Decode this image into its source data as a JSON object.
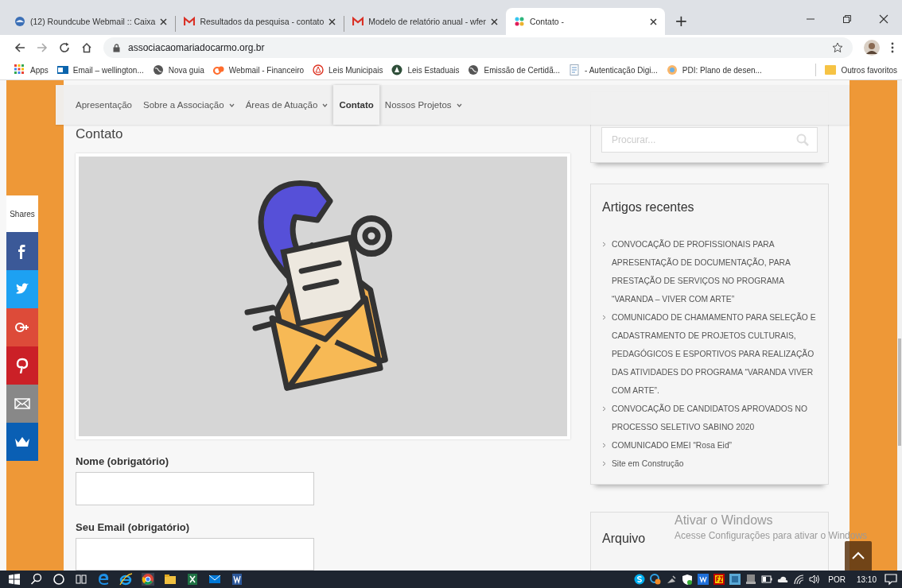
{
  "browser": {
    "tabs": [
      {
        "title": "(12) Roundcube Webmail :: Caixa",
        "selected": false
      },
      {
        "title": "Resultados da pesquisa - contato",
        "selected": false
      },
      {
        "title": "Modelo de relatório anual - wfer",
        "selected": false
      },
      {
        "title": "Contato -",
        "selected": true
      }
    ],
    "new_tab": "+",
    "address": "associacaomariadocarmo.org.br",
    "bookmarks": [
      {
        "label": "Apps"
      },
      {
        "label": "Email – wellington..."
      },
      {
        "label": "Nova guia"
      },
      {
        "label": "Webmail - Financeiro"
      },
      {
        "label": "Leis Municipais"
      },
      {
        "label": "Leis Estaduais"
      },
      {
        "label": "Emissão de Certidã..."
      },
      {
        "label": "- Autenticação Digi..."
      },
      {
        "label": "PDI: Plano de desen..."
      }
    ],
    "other_bookmarks": "Outros favoritos"
  },
  "nav": {
    "items": [
      {
        "label": "Apresentação",
        "has_submenu": false,
        "selected": false
      },
      {
        "label": "Sobre a Associação",
        "has_submenu": true,
        "selected": false
      },
      {
        "label": "Áreas de Atuação",
        "has_submenu": true,
        "selected": false
      },
      {
        "label": "Contato",
        "has_submenu": false,
        "selected": true
      },
      {
        "label": "Nossos Projetos",
        "has_submenu": true,
        "selected": false
      }
    ]
  },
  "share_bar": {
    "label": "Shares",
    "buttons": [
      {
        "kind": "facebook"
      },
      {
        "kind": "twitter"
      },
      {
        "kind": "googleplus"
      },
      {
        "kind": "pinterest"
      },
      {
        "kind": "email"
      },
      {
        "kind": "crown"
      }
    ]
  },
  "main": {
    "heading": "Contato",
    "form": [
      {
        "label": "Nome (obrigatório)"
      },
      {
        "label": "Seu Email (obrigatório)"
      }
    ]
  },
  "sidebar": {
    "search": {
      "placeholder": "Procurar..."
    },
    "recent": {
      "title": "Artigos recentes",
      "items": [
        "CONVOCAÇÃO DE PROFISSIONAIS PARA APRESENTAÇÃO DE DOCUMENTAÇÃO, PARA PRESTAÇÃO DE SERVIÇOS NO PROGRAMA “VARANDA – VIVER COM ARTE”",
        "COMUNICADO DE CHAMAMENTO PARA SELEÇÃO E CADASTRAMENTO DE PROJETOS CULTURAIS, PEDAGÓGICOS E ESPORTIVOS PARA REALIZAÇÃO DAS ATIVIDADES DO PROGRAMA “VARANDA VIVER COM ARTE”.",
        "CONVOCAÇÃO DE CANDIDATOS APROVADOS NO PROCESSO SELETIVO SABINO 2020",
        "COMUNICADO EMEI “Rosa Eid”",
        "Site em Construção"
      ]
    },
    "archive": {
      "title": "Arquivo"
    }
  },
  "activation": {
    "title": "Ativar o Windows",
    "text": "Acesse Configurações para ativar o Windows"
  },
  "taskbar": {
    "language": "POR",
    "time": "13:10"
  }
}
